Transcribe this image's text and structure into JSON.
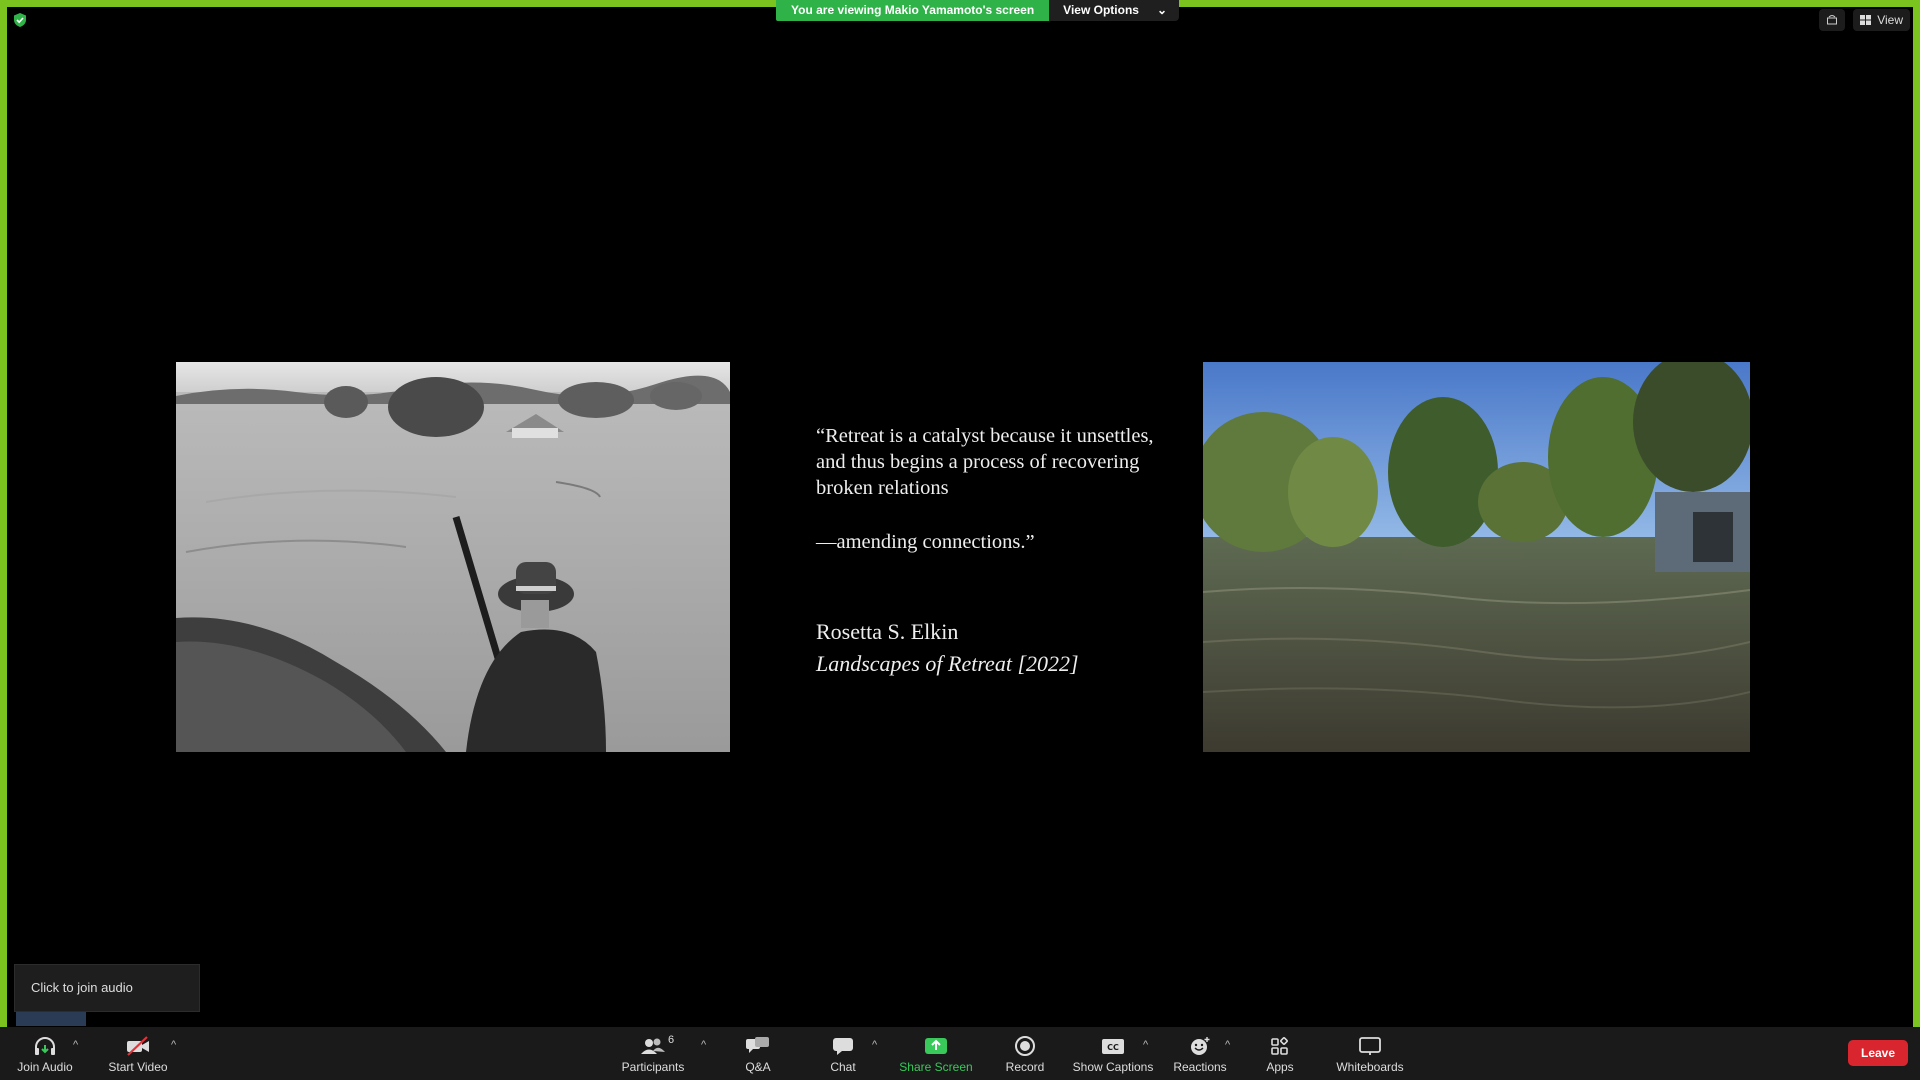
{
  "banner": {
    "message": "You are viewing Makio Yamamoto's screen",
    "view_options": "View Options"
  },
  "top_right": {
    "view_label": "View"
  },
  "slide": {
    "quote_line1": "“Retreat is a catalyst because it unsettles, and thus begins a process of recovering broken relations",
    "quote_line2": "—amending connections.”",
    "author": "Rosetta S. Elkin",
    "book": "Landscapes of Retreat [2022]"
  },
  "join_tip": "Click to join audio",
  "toolbar": {
    "join_audio": "Join Audio",
    "start_video": "Start Video",
    "participants": "Participants",
    "participants_count": "6",
    "qa": "Q&A",
    "chat": "Chat",
    "share_screen": "Share Screen",
    "record": "Record",
    "show_captions": "Show Captions",
    "reactions": "Reactions",
    "apps": "Apps",
    "whiteboards": "Whiteboards",
    "leave": "Leave"
  },
  "colors": {
    "share_border": "#7bc31f",
    "banner_green": "#2fb348",
    "leave_red": "#d9262e"
  }
}
